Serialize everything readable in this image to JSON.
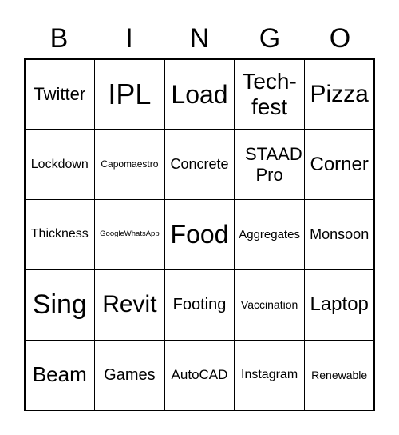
{
  "header": [
    "B",
    "I",
    "N",
    "G",
    "O"
  ],
  "cells": [
    "Twitter",
    "IPL",
    "Load",
    "Tech-fest",
    "Pizza",
    "Lockdown",
    "Capomaestro",
    "Concrete",
    "STAAD Pro",
    "Corner",
    "Thickness",
    "GoogleWhatsApp",
    "Food",
    "Aggregates",
    "Monsoon",
    "Sing",
    "Revit",
    "Footing",
    "Vaccination",
    "Laptop",
    "Beam",
    "Games",
    "AutoCAD",
    "Instagram",
    "Renewable"
  ]
}
